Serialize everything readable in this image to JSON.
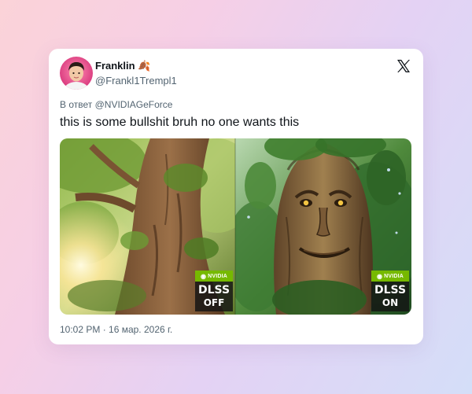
{
  "tweet": {
    "display_name": "Franklin 🍂",
    "handle": "@Frankl1Trempl1",
    "reply_to": "В ответ @NVIDIAGeForce",
    "text": "this is some bullshit bruh no one wants this",
    "timestamp": "10:02 PM · 16 мар. 2026 г."
  },
  "media": {
    "left_badge": {
      "brand": "NVIDIA",
      "line1": "DLSS",
      "line2": "OFF"
    },
    "right_badge": {
      "brand": "NVIDIA",
      "line1": "DLSS",
      "line2": "ON"
    }
  },
  "icons": [
    "avatar",
    "x-logo-icon"
  ],
  "colors": {
    "nvidia_green": "#76b900",
    "text": "#0f1419",
    "muted": "#536471"
  }
}
